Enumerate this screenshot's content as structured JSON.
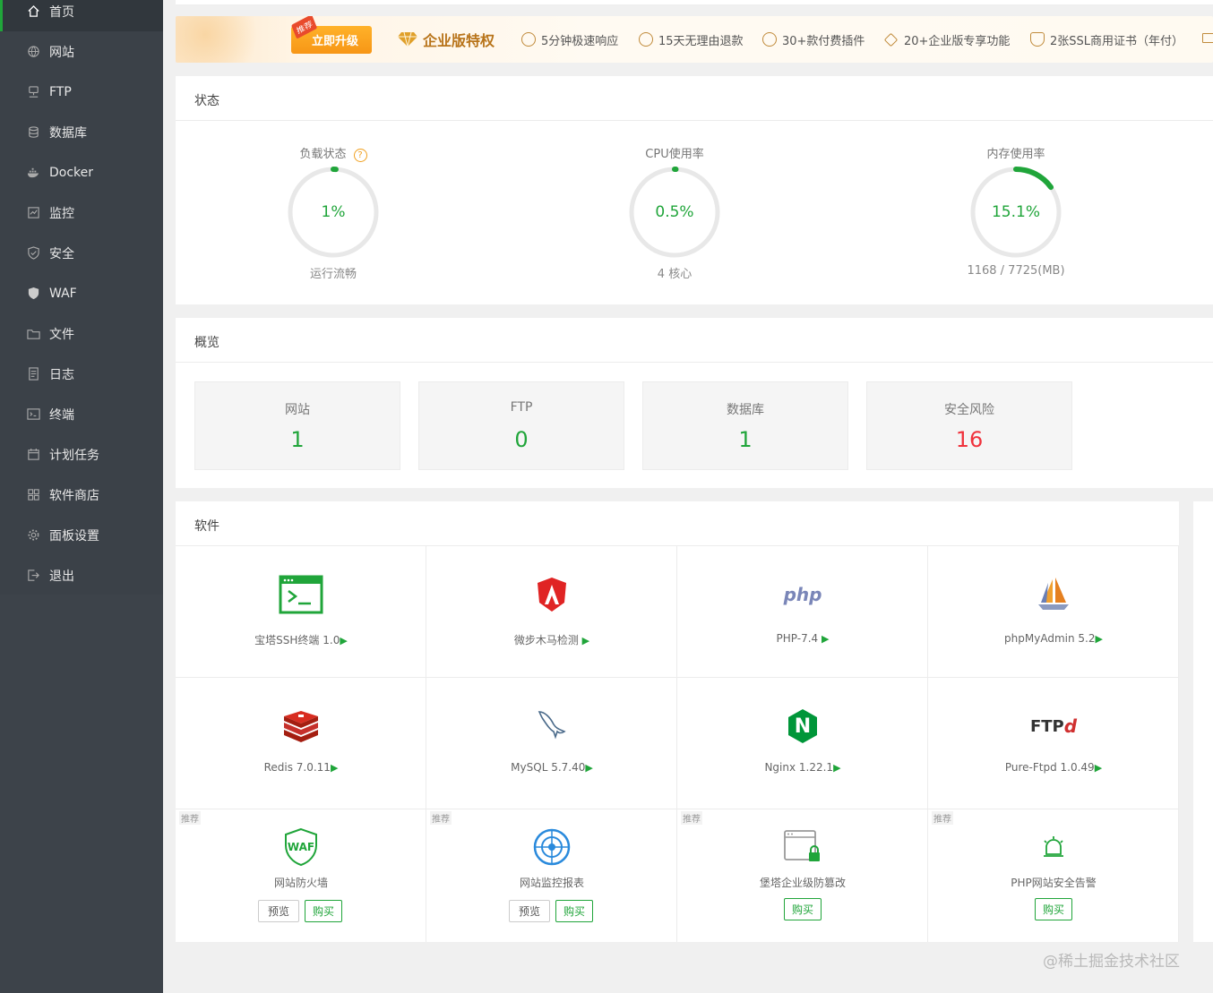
{
  "sidebar": {
    "items": [
      {
        "label": "首页",
        "icon": "home-icon",
        "active": true
      },
      {
        "label": "网站",
        "icon": "globe-icon"
      },
      {
        "label": "FTP",
        "icon": "ftp-icon"
      },
      {
        "label": "数据库",
        "icon": "database-icon"
      },
      {
        "label": "Docker",
        "icon": "docker-icon"
      },
      {
        "label": "监控",
        "icon": "monitor-icon"
      },
      {
        "label": "安全",
        "icon": "shield-icon"
      },
      {
        "label": "WAF",
        "icon": "waf-icon"
      },
      {
        "label": "文件",
        "icon": "folder-icon"
      },
      {
        "label": "日志",
        "icon": "log-icon"
      },
      {
        "label": "终端",
        "icon": "terminal-icon"
      },
      {
        "label": "计划任务",
        "icon": "calendar-icon"
      },
      {
        "label": "软件商店",
        "icon": "grid-icon"
      },
      {
        "label": "面板设置",
        "icon": "gear-icon"
      },
      {
        "label": "退出",
        "icon": "logout-icon"
      }
    ]
  },
  "banner": {
    "tag": "推荐",
    "upgrade_label": "立即升级",
    "title": "企业版特权",
    "features": [
      "5分钟极速响应",
      "15天无理由退款",
      "30+款付费插件",
      "20+企业版专享功能",
      "2张SSL商用证书（年付）"
    ]
  },
  "status": {
    "title": "状态",
    "gauges": [
      {
        "label": "负载状态",
        "value_text": "1%",
        "percent": 1,
        "sub": "运行流畅",
        "has_help": true
      },
      {
        "label": "CPU使用率",
        "value_text": "0.5%",
        "percent": 0.5,
        "sub": "4 核心",
        "has_help": false
      },
      {
        "label": "内存使用率",
        "value_text": "15.1%",
        "percent": 15.1,
        "sub": "1168 / 7725(MB)",
        "has_help": false
      }
    ],
    "help_glyph": "?"
  },
  "overview": {
    "title": "概览",
    "cards": [
      {
        "label": "网站",
        "value": "1"
      },
      {
        "label": "FTP",
        "value": "0"
      },
      {
        "label": "数据库",
        "value": "1"
      },
      {
        "label": "安全风险",
        "value": "16",
        "danger": true
      }
    ]
  },
  "software": {
    "title": "软件",
    "play_glyph": "▶",
    "items": [
      {
        "name": "宝塔SSH终端 1.0",
        "icon": "terminal-window-icon"
      },
      {
        "name": "微步木马检测 ",
        "icon": "trojan-shield-icon"
      },
      {
        "name": "PHP-7.4 ",
        "icon": "php-icon",
        "icon_text": "php"
      },
      {
        "name": "phpMyAdmin 5.2",
        "icon": "sailboat-icon"
      },
      {
        "name": "Redis 7.0.11",
        "icon": "redis-icon"
      },
      {
        "name": "MySQL 5.7.40",
        "icon": "dolphin-icon"
      },
      {
        "name": "Nginx 1.22.1",
        "icon": "nginx-icon",
        "icon_text": "N"
      },
      {
        "name": "Pure-Ftpd 1.0.49",
        "icon": "ftpd-icon",
        "icon_text": "FTP",
        "icon_text2": "d"
      }
    ],
    "recommended": [
      {
        "tag": "推荐",
        "name": "网站防火墙",
        "icon": "waf-shield-icon",
        "icon_text": "WAF",
        "preview": "预览",
        "buy": "购买"
      },
      {
        "tag": "推荐",
        "name": "网站监控报表",
        "icon": "radar-icon",
        "preview": "预览",
        "buy": "购买"
      },
      {
        "tag": "推荐",
        "name": "堡塔企业级防篡改",
        "icon": "lock-window-icon",
        "buy": "购买"
      },
      {
        "tag": "推荐",
        "name": "PHP网站安全告警",
        "icon": "alarm-icon",
        "buy": "购买"
      }
    ]
  },
  "watermark": "@稀土掘金技术社区",
  "colors": {
    "accent": "#20a53a",
    "danger": "#f0323c",
    "sidebar": "#3b4148"
  }
}
